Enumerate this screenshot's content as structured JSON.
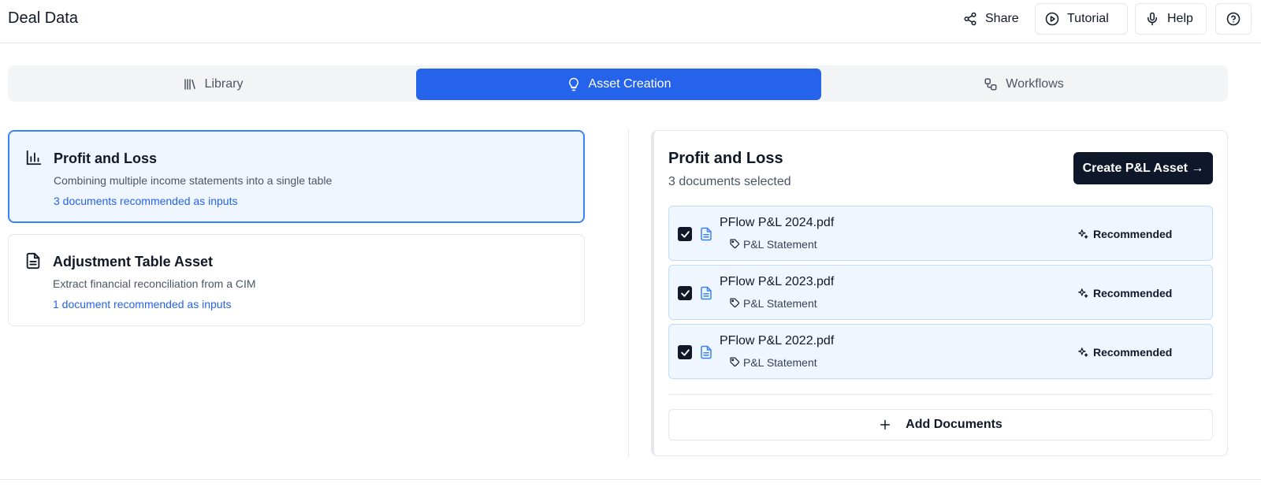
{
  "header": {
    "title": "Deal Data",
    "share_label": "Share",
    "tutorial_label": "Tutorial",
    "help_label": "Help"
  },
  "tabs": [
    {
      "label": "Library",
      "icon": "library-icon"
    },
    {
      "label": "Asset Creation",
      "icon": "lightbulb-icon",
      "active": true
    },
    {
      "label": "Workflows",
      "icon": "workflow-icon"
    }
  ],
  "asset_types": [
    {
      "title": "Profit and Loss",
      "description": "Combining multiple income statements into a single table",
      "recommendation": "3 documents recommended as inputs",
      "icon": "bar-chart-icon",
      "selected": true
    },
    {
      "title": "Adjustment Table Asset",
      "description": "Extract financial reconciliation from a CIM",
      "recommendation": "1 document recommended as inputs",
      "icon": "document-icon",
      "selected": false
    }
  ],
  "panel": {
    "title": "Profit and Loss",
    "subtitle": "3 documents selected",
    "create_button": "Create P&L Asset →",
    "documents": [
      {
        "name": "PFlow P&L 2024.pdf",
        "tag": "P&L Statement",
        "badge": "Recommended",
        "checked": true
      },
      {
        "name": "PFlow P&L 2023.pdf",
        "tag": "P&L Statement",
        "badge": "Recommended",
        "checked": true
      },
      {
        "name": "PFlow P&L 2022.pdf",
        "tag": "P&L Statement",
        "badge": "Recommended",
        "checked": true
      }
    ],
    "add_button": "Add Documents"
  },
  "colors": {
    "accent": "#2563eb",
    "selected_bg": "#eff6ff",
    "primary_dark": "#0f172a"
  }
}
